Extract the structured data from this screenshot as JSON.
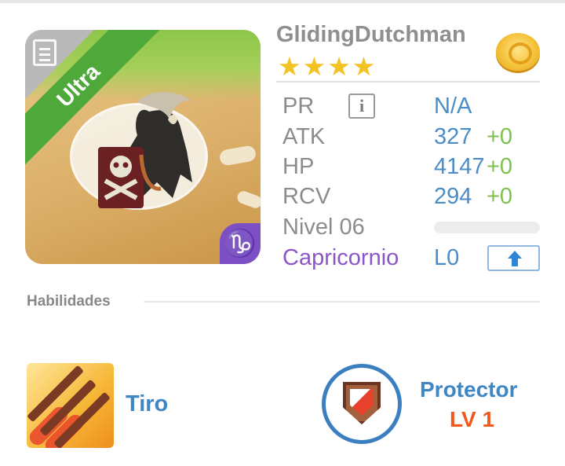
{
  "monster": {
    "name": "GlidingDutchman",
    "stars": 4,
    "rarity": "Ultra",
    "zodiac_symbol": "♑"
  },
  "stats": {
    "pr": {
      "label": "PR",
      "value": "N/A"
    },
    "atk": {
      "label": "ATK",
      "value": "327",
      "bonus": "+0"
    },
    "hp": {
      "label": "HP",
      "value": "4147",
      "bonus": "+0"
    },
    "rcv": {
      "label": "RCV",
      "value": "294",
      "bonus": "+0"
    },
    "level": {
      "label": "Nivel 06",
      "progress": 0
    },
    "zodiac": {
      "label": "Capricornio",
      "limit": "L0"
    }
  },
  "icons": {
    "info": "info-icon",
    "upgrade": "arrow-up-icon",
    "currency": "gold-coin-icon",
    "calendar": "calendar-icon"
  },
  "skills": {
    "title": "Habilidades",
    "active": {
      "name": "Tiro"
    },
    "leader": {
      "name": "Protector",
      "level": "LV 1"
    }
  },
  "colors": {
    "accent_blue": "#4a8dc8",
    "bonus_green": "#7ec14f",
    "zodiac_purple": "#8b56c8",
    "star_gold": "#f3c223",
    "level_orange": "#f0581c",
    "rarity_green": "#4fa83a"
  }
}
